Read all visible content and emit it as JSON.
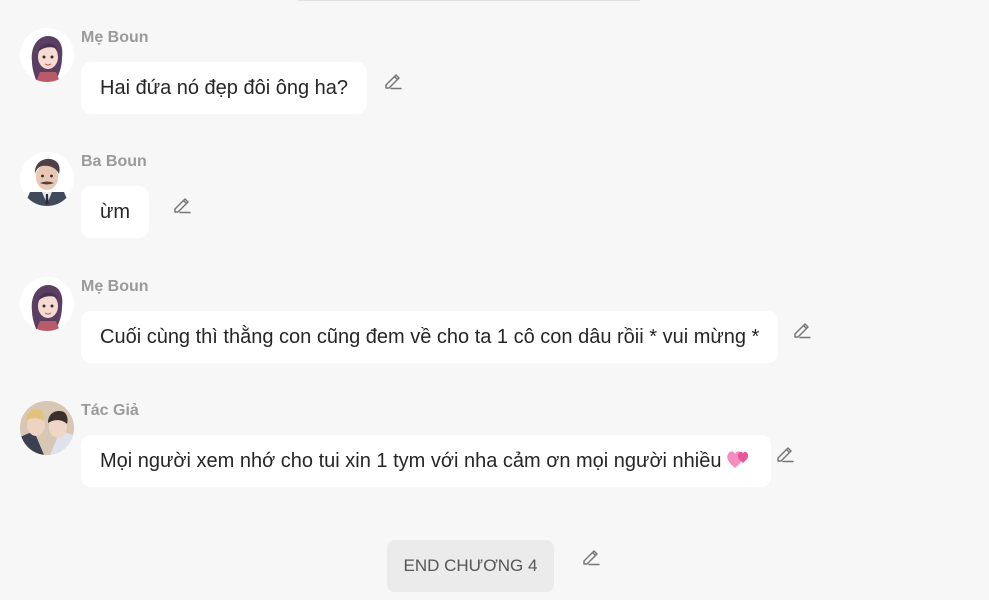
{
  "messages": [
    {
      "sender": "Mẹ Boun",
      "text": "Hai đứa nó đẹp đôi ông ha?",
      "avatar": "mother-avatar"
    },
    {
      "sender": "Ba Boun",
      "text": "ừm",
      "avatar": "father-avatar"
    },
    {
      "sender": "Mẹ Boun",
      "text": "Cuối cùng thì thằng con cũng đem về cho ta 1 cô con dâu rồii * vui mừng *",
      "avatar": "mother-avatar"
    },
    {
      "sender": "Tác Giả",
      "text": "Mọi người xem nhớ cho tui xin 1 tym với nha cảm ơn mọi người nhiều",
      "avatar": "author-avatar",
      "emoji": "two-hearts-icon"
    }
  ],
  "end_button": {
    "label": "END CHƯƠNG 4"
  },
  "icons": {
    "edit": "pencil-edit-icon"
  },
  "colors": {
    "background": "#f7f7f7",
    "bubble": "#ffffff",
    "sender_name": "#9a9a9a",
    "heart": "#e8559a"
  }
}
